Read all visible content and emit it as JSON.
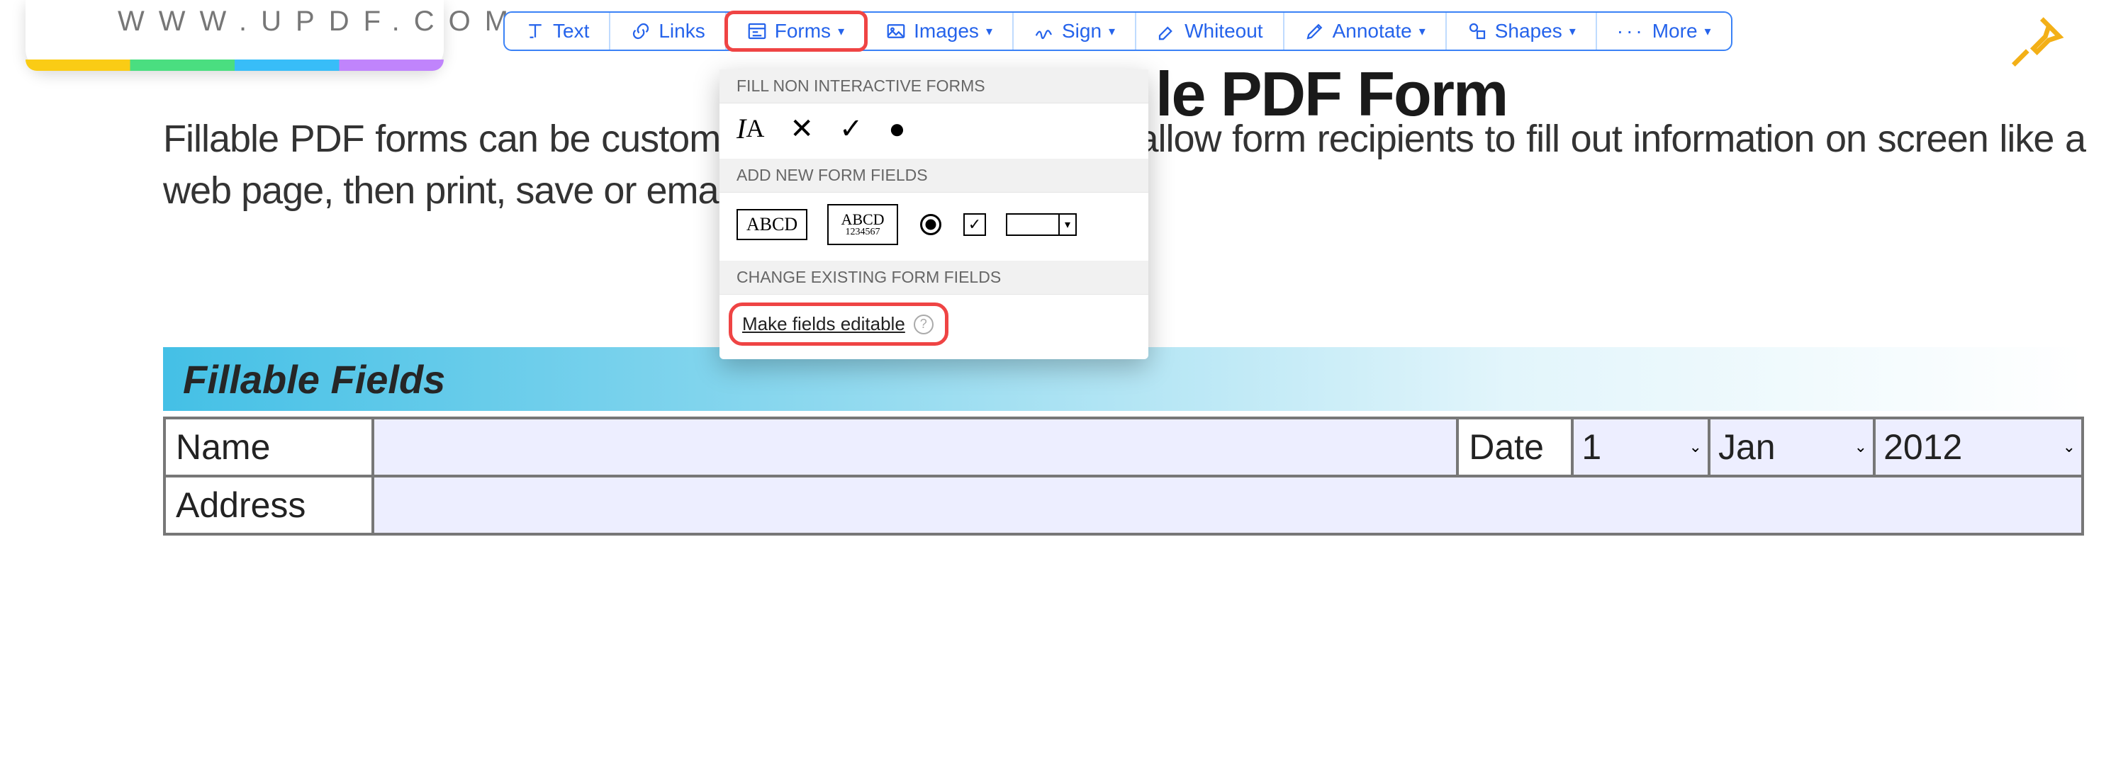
{
  "logo": {
    "url_text": "WWW.UPDF.COM"
  },
  "toolbar": {
    "text": "Text",
    "links": "Links",
    "forms": "Forms",
    "images": "Images",
    "sign": "Sign",
    "whiteout": "Whiteout",
    "annotate": "Annotate",
    "shapes": "Shapes",
    "more": "More"
  },
  "dropdown": {
    "section1": "FILL NON INTERACTIVE FORMS",
    "section2": "ADD NEW FORM FIELDS",
    "section3": "CHANGE EXISTING FORM FIELDS",
    "sample_text_single": "ABCD",
    "sample_text_multi_top": "ABCD",
    "sample_text_multi_bottom": "1234567",
    "make_editable": "Make fields editable"
  },
  "doc": {
    "title_fragment": "le PDF Form",
    "paragraph": "Fillable PDF forms can be customised to your needs. They allow form recipients to fill out information on screen like a web page, then print, save or email the results."
  },
  "table": {
    "header": "Fillable Fields",
    "rows": {
      "name_label": "Name",
      "date_label": "Date",
      "address_label": "Address"
    },
    "date_day": "1",
    "date_month": "Jan",
    "date_year": "2012"
  }
}
